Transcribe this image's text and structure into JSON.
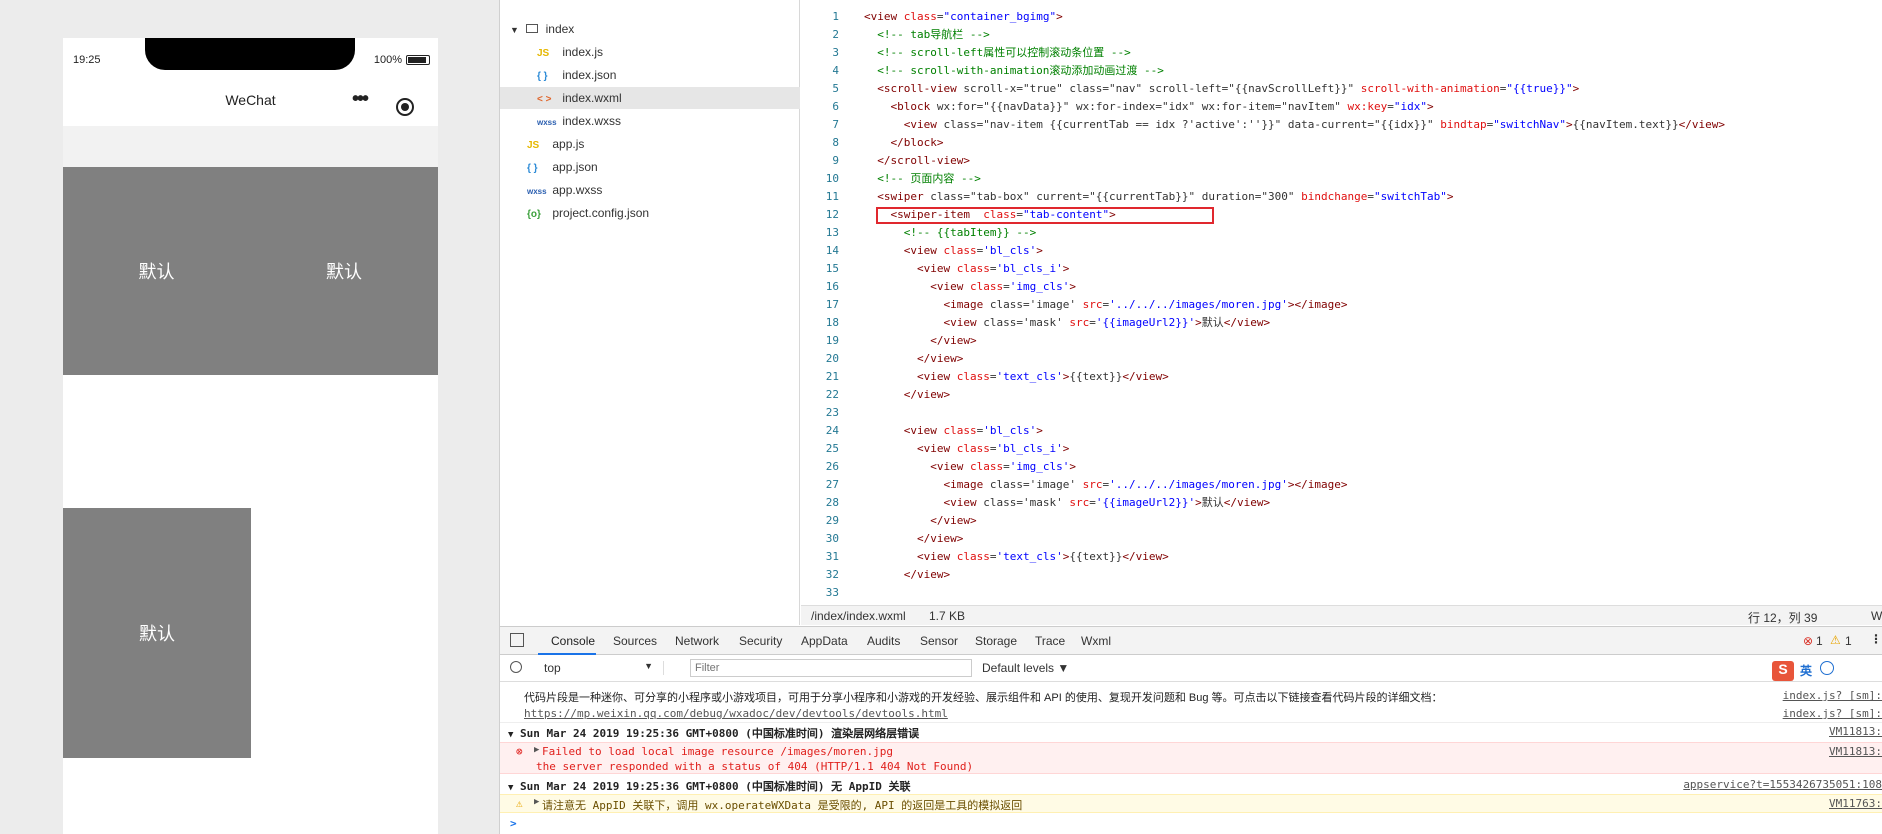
{
  "simulator": {
    "time": "19:25",
    "battery": "100%",
    "nav_title": "WeChat",
    "tiles": [
      "默认",
      "默认",
      "默认"
    ]
  },
  "file_tree": {
    "folder": "index",
    "items": [
      {
        "icon": "JS",
        "name": "index.js"
      },
      {
        "icon": "{ }",
        "name": "index.json"
      },
      {
        "icon": "< >",
        "name": "index.wxml"
      },
      {
        "icon": "wxss",
        "name": "index.wxss"
      },
      {
        "icon": "JS",
        "name": "app.js"
      },
      {
        "icon": "{ }",
        "name": "app.json"
      },
      {
        "icon": "wxss",
        "name": "app.wxss"
      },
      {
        "icon": "{o}",
        "name": "project.config.json"
      }
    ]
  },
  "editor": {
    "line_numbers": [
      "1",
      "2",
      "3",
      "4",
      "5",
      "6",
      "7",
      "8",
      "9",
      "10",
      "11",
      "12",
      "13",
      "14",
      "15",
      "16",
      "17",
      "18",
      "19",
      "20",
      "21",
      "22",
      "23",
      "24",
      "25",
      "26",
      "27",
      "28",
      "29",
      "30",
      "31",
      "32",
      "33"
    ],
    "lines": [
      "<view class=\"container_bgimg\">",
      "  <!-- tab导航栏 -->",
      "  <!-- scroll-left属性可以控制滚动条位置 -->",
      "  <!-- scroll-with-animation滚动添加动画过渡 -->",
      "  <scroll-view scroll-x=\"true\" class=\"nav\" scroll-left=\"{{navScrollLeft}}\" scroll-with-animation=\"{{true}}\">",
      "    <block wx:for=\"{{navData}}\" wx:for-index=\"idx\" wx:for-item=\"navItem\" wx:key=\"idx\">",
      "      <view class=\"nav-item {{currentTab == idx ?'active':''}}\" data-current=\"{{idx}}\" bindtap=\"switchNav\">{{navItem.text}}</view>",
      "    </block>",
      "  </scroll-view>",
      "  <!-- 页面内容 -->",
      "  <swiper class=\"tab-box\" current=\"{{currentTab}}\" duration=\"300\" bindchange=\"switchTab\">",
      "    <swiper-item  class=\"tab-content\">",
      "      <!-- {{tabItem}} -->",
      "      <view class='bl_cls'>",
      "        <view class='bl_cls_i'>",
      "          <view class='img_cls'>",
      "            <image class='image' src='../../../images/moren.jpg'></image>",
      "            <view class='mask' src='{{imageUrl2}}'>默认</view>",
      "          </view>",
      "        </view>",
      "        <view class='text_cls'>{{text}}</view>",
      "      </view>",
      "",
      "      <view class='bl_cls'>",
      "        <view class='bl_cls_i'>",
      "          <view class='img_cls'>",
      "            <image class='image' src='../../../images/moren.jpg'></image>",
      "            <view class='mask' src='{{imageUrl2}}'>默认</view>",
      "          </view>",
      "        </view>",
      "        <view class='text_cls'>{{text}}</view>",
      "      </view>",
      ""
    ],
    "status_path": "/index/index.wxml",
    "status_size": "1.7 KB",
    "status_position": "行 12，列 39",
    "status_right": "W"
  },
  "devtools": {
    "tabs": [
      "Console",
      "Sources",
      "Network",
      "Security",
      "AppData",
      "Audits",
      "Sensor",
      "Storage",
      "Trace",
      "Wxml"
    ],
    "active_tab": "Console",
    "error_count": "1",
    "warn_count": "1",
    "context": "top",
    "filter_placeholder": "Filter",
    "levels": "Default levels ▼",
    "ime_label": "英",
    "logs": {
      "intro": "代码片段是一种迷你、可分享的小程序或小游戏项目，可用于分享小程序和小游戏的开发经验、展示组件和 API 的使用、复现开发问题和 Bug 等。可点击以下链接查看代码片段的详细文档：",
      "intro_src": "index.js? [sm]:",
      "link": "https://mp.weixin.qq.com/debug/wxadoc/dev/devtools/devtools.html",
      "link_src": "index.js? [sm]:",
      "group1": "Sun Mar 24 2019 19:25:36 GMT+0800 (中国标准时间) 渲染层网络层错误",
      "group1_src": "VM11813:",
      "error1": "Failed to load local image resource /images/moren.jpg",
      "error1_src": "VM11813:",
      "error2": "the server responded with a status of 404 (HTTP/1.1 404 Not Found)",
      "group2": "Sun Mar 24 2019 19:25:36 GMT+0800 (中国标准时间) 无 AppID 关联",
      "group2_src": "appservice?t=1553426735051:108",
      "warn": "请注意无 AppID 关联下，调用 wx.operateWXData 是受限的, API 的返回是工具的模拟返回",
      "warn_src": "VM11763:",
      "prompt": ">"
    }
  }
}
